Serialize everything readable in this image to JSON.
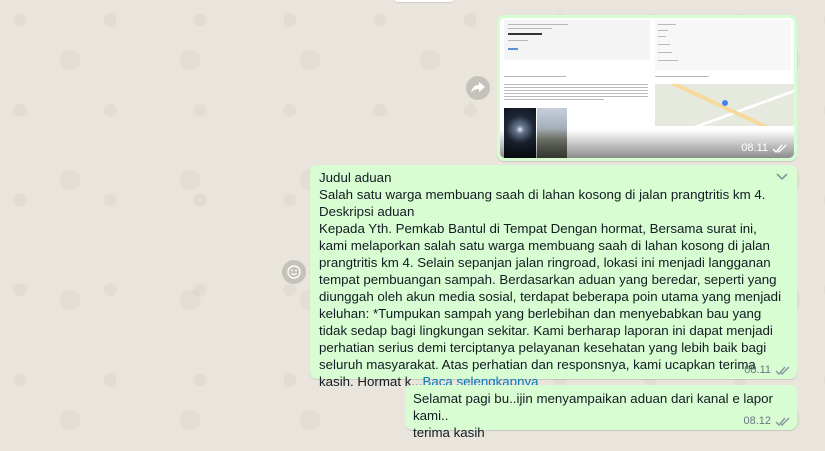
{
  "colors": {
    "outgoing_bubble": "#d9fdd3",
    "wallpaper": "#e9e4dc",
    "link": "#027eb5",
    "meta": "#667781"
  },
  "image_message": {
    "time": "08.11",
    "status_icon": "double-check-icon"
  },
  "forward_button": {
    "icon": "forward-icon"
  },
  "long_message": {
    "text_lines": [
      "Judul aduan",
      "Salah satu warga membuang saah di lahan kosong di jalan prangtritis km 4.",
      "Deskripsi aduan",
      "Kepada Yth. Pemkab Bantul di Tempat Dengan hormat, Bersama surat ini, kami melaporkan salah satu warga membuang saah di lahan kosong di jalan prangtritis km 4. Selain sepanjan jalan ringroad, lokasi ini menjadi langganan tempat pembuangan sampah. Berdasarkan aduan yang beredar, seperti yang diunggah oleh akun media sosial, terdapat beberapa poin utama yang menjadi keluhan: *Tumpukan sampah yang berlebihan dan menyebabkan bau yang tidak sedap bagi lingkungan sekitar. Kami berharap laporan ini dapat menjadi perhatian serius demi terciptanya pelayanan kesehatan yang lebih baik bagi seluruh masyarakat. Atas perhatian dan responsnya, kami ucapkan terima kasih. Hormat k..."
    ],
    "read_more": "Baca selengkapnya",
    "time": "08.11",
    "status_icon": "double-check-icon",
    "menu_icon": "chevron-down-icon"
  },
  "react_button": {
    "icon": "emoji-icon"
  },
  "short_message": {
    "text": "Selamat pagi bu..ijin menyampaikan aduan dari kanal e lapor kami..\nterima kasih",
    "time": "08.12",
    "status_icon": "double-check-icon"
  }
}
